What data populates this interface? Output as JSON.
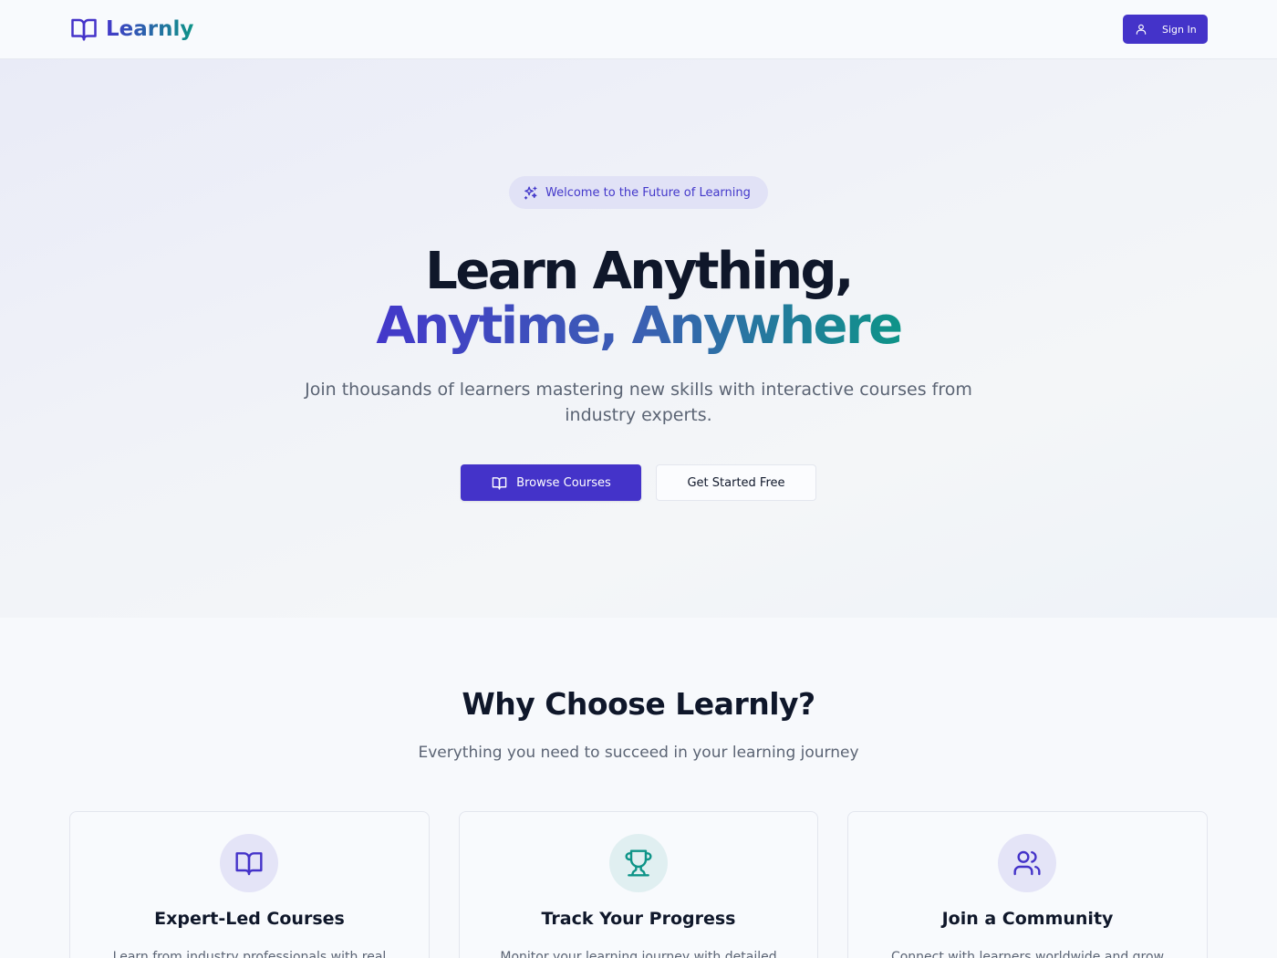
{
  "header": {
    "brand": "Learnly",
    "signin_label": "Sign In",
    "brand_icon": "book-open-icon",
    "signin_icon": "user-icon"
  },
  "hero": {
    "badge": "Welcome to the Future of Learning",
    "badge_icon": "sparkles-icon",
    "title_line1": "Learn Anything,",
    "title_line2": "Anytime, Anywhere",
    "subtitle": "Join thousands of learners mastering new skills with interactive courses from industry experts.",
    "primary_button": "Browse Courses",
    "secondary_button": "Get Started Free"
  },
  "features": {
    "title": "Why Choose Learnly?",
    "subtitle": "Everything you need to succeed in your learning journey",
    "cards": [
      {
        "icon": "book-open-icon",
        "title": "Expert-Led Courses",
        "description": "Learn from industry professionals with real"
      },
      {
        "icon": "trophy-icon",
        "title": "Track Your Progress",
        "description": "Monitor your learning journey with detailed"
      },
      {
        "icon": "users-icon",
        "title": "Join a Community",
        "description": "Connect with learners worldwide and grow"
      }
    ]
  },
  "colors": {
    "brand_indigo": "#4433c9",
    "brand_teal": "#0e9488",
    "text_dark": "#0f172a",
    "text_muted": "#5b6474"
  }
}
